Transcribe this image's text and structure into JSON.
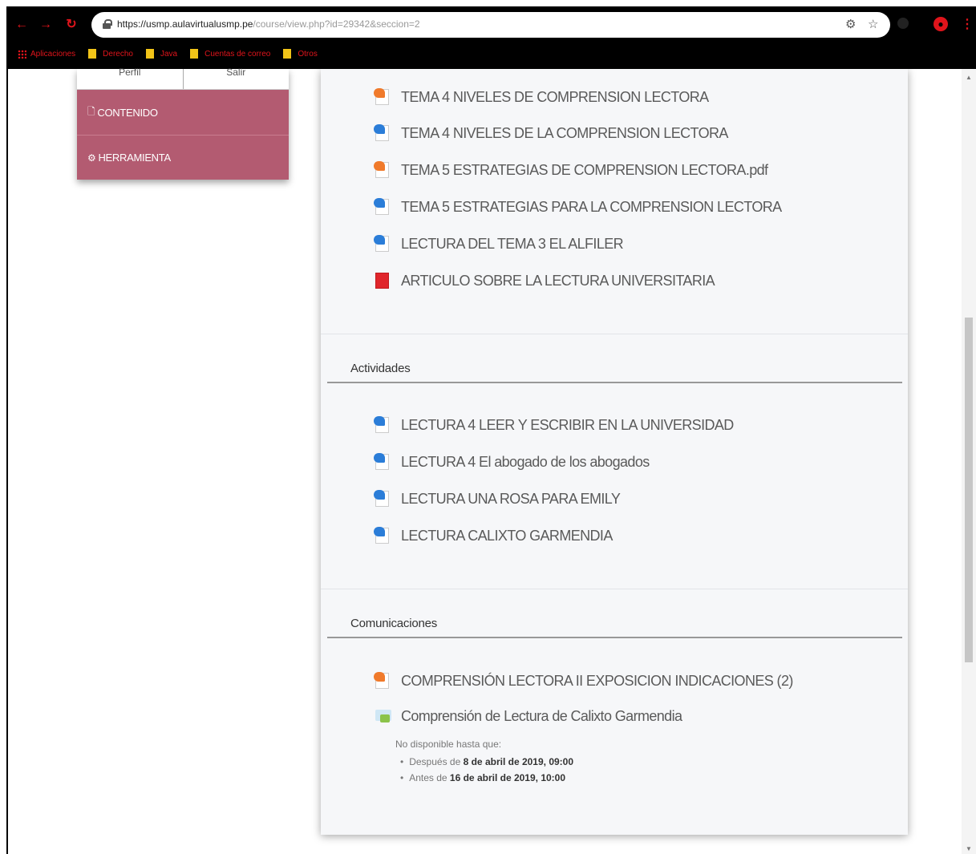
{
  "browser": {
    "url_host": "https://usmp.aulavirtualusmp.pe",
    "url_path": "/course/view.php?id=29342&seccion=2",
    "bookmarks": [
      "Aplicaciones",
      "Derecho",
      "Java",
      "Cuentas de correo",
      "Otros"
    ],
    "accent_color": "#e0141b"
  },
  "sidebar": {
    "top_links": [
      "Perfil",
      "Salir"
    ],
    "items": [
      {
        "label": "CONTENIDO",
        "icon": "file-icon"
      },
      {
        "label": "HERRAMIENTA",
        "icon": "gears-icon"
      }
    ],
    "color": "#b35b71"
  },
  "resources": [
    {
      "label": "TEMA 4 NIVELES DE COMPRENSION LECTORA",
      "icon": "orange"
    },
    {
      "label": "TEMA 4 NIVELES DE LA COMPRENSION LECTORA",
      "icon": "blue"
    },
    {
      "label": "TEMA 5 ESTRATEGIAS DE COMPRENSION LECTORA.pdf",
      "icon": "orange"
    },
    {
      "label": "TEMA 5 ESTRATEGIAS PARA LA COMPRENSION LECTORA",
      "icon": "blue"
    },
    {
      "label": "LECTURA DEL TEMA 3 EL ALFILER",
      "icon": "blue"
    },
    {
      "label": "ARTICULO SOBRE LA LECTURA UNIVERSITARIA",
      "icon": "red"
    }
  ],
  "actividades": {
    "title": "Actividades",
    "items": [
      {
        "label": "LECTURA 4 LEER Y ESCRIBIR EN LA UNIVERSIDAD",
        "icon": "blue"
      },
      {
        "label": "LECTURA 4 El abogado de los abogados",
        "icon": "blue"
      },
      {
        "label": "LECTURA UNA ROSA PARA EMILY",
        "icon": "blue"
      },
      {
        "label": "LECTURA CALIXTO GARMENDIA",
        "icon": "blue"
      }
    ]
  },
  "comunicaciones": {
    "title": "Comunicaciones",
    "items": [
      {
        "label": "COMPRENSIÓN LECTORA II EXPOSICION INDICACIONES (2)",
        "icon": "orange"
      },
      {
        "label": "Comprensión de Lectura de Calixto Garmendia",
        "icon": "chat"
      }
    ],
    "restriction": {
      "intro": "No disponible hasta que:",
      "after_prefix": "Después de",
      "after_date": "8 de abril de 2019, 09:00",
      "before_prefix": "Antes de",
      "before_date": "16 de abril de 2019, 10:00"
    }
  }
}
